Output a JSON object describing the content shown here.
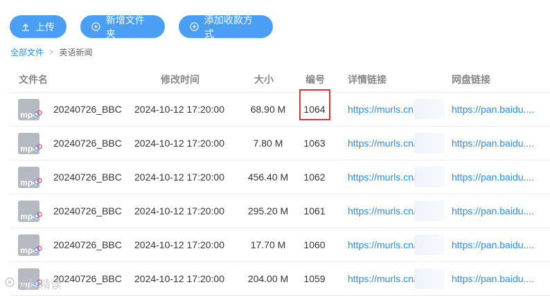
{
  "toolbar": {
    "upload_label": "上传",
    "new_folder_label": "新增文件夹",
    "add_payment_label": "添加收款方式",
    "accent_color": "#4a9ff5"
  },
  "breadcrumb": {
    "root": "全部文件",
    "separator": ">",
    "current": "英语新闻"
  },
  "table": {
    "headers": {
      "name": "文件名",
      "time": "修改时间",
      "size": "大小",
      "id": "编号",
      "detail": "详情链接",
      "pan": "网盘链接"
    },
    "rows": [
      {
        "icon": "mp4",
        "name": "20240726_BBC",
        "time": "2024-10-12 17:20:00",
        "size": "68.90 M",
        "id": "1064",
        "detail": "https://murls.cn",
        "pan": "https://pan.baidu...."
      },
      {
        "icon": "mp4",
        "name": "20240726_BBC",
        "time": "2024-10-12 17:20:00",
        "size": "7.80 M",
        "id": "1063",
        "detail": "https://murls.cn/",
        "pan": "https://pan.baidu...."
      },
      {
        "icon": "mp4",
        "name": "20240726_BBC",
        "time": "2024-10-12 17:20:00",
        "size": "456.40 M",
        "id": "1062",
        "detail": "https://murls.cn/",
        "pan": "https://pan.baidu...."
      },
      {
        "icon": "mp4",
        "name": "20240726_BBC",
        "time": "2024-10-12 17:20:00",
        "size": "295.20 M",
        "id": "1061",
        "detail": "https://murls.cn/",
        "pan": "https://pan.baidu...."
      },
      {
        "icon": "mp4",
        "name": "20240726_BBC",
        "time": "2024-10-12 17:20:00",
        "size": "17.70 M",
        "id": "1060",
        "detail": "https://murls.cn/",
        "pan": "https://pan.baidu...."
      },
      {
        "icon": "mp4",
        "name": "20240726_BBC",
        "time": "2024-10-12 17:20:00",
        "size": "204.00 M",
        "id": "1059",
        "detail": "https://murls.cn/",
        "pan": "https://pan.baidu...."
      }
    ]
  },
  "watermark": "大秋精读",
  "highlight_color": "#d6323a"
}
